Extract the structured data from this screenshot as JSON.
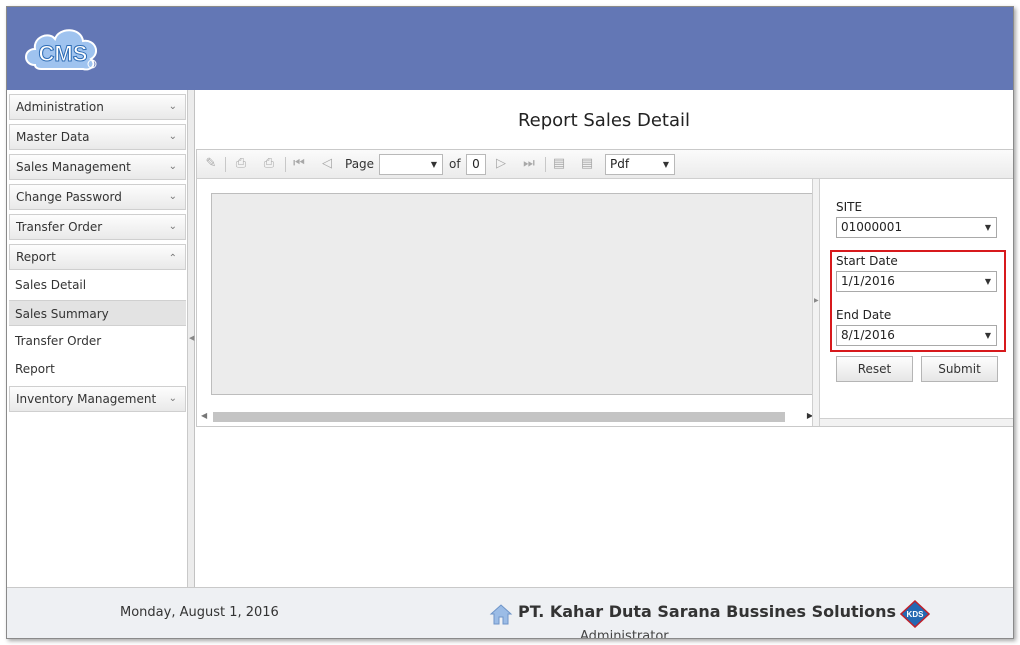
{
  "header": {
    "logo_text": "CMS"
  },
  "sidebar": {
    "items": [
      {
        "label": "Administration",
        "chevron": "chevron-down-icon"
      },
      {
        "label": "Master Data",
        "chevron": "chevron-down-icon"
      },
      {
        "label": "Sales Management",
        "chevron": "chevron-down-icon"
      },
      {
        "label": "Change Password",
        "chevron": "chevron-down-icon"
      },
      {
        "label": "Transfer Order",
        "chevron": "chevron-down-icon"
      },
      {
        "label": "Report",
        "chevron": "chevron-up-icon",
        "expanded": true
      },
      {
        "label": "Inventory Management",
        "chevron": "chevron-down-icon"
      }
    ],
    "report_subitems": [
      {
        "label": "Sales Detail"
      },
      {
        "label": "Sales Summary",
        "selected": true
      },
      {
        "label": "Transfer Order"
      },
      {
        "label": "Report"
      }
    ]
  },
  "main": {
    "title": "Report Sales Detail",
    "toolbar": {
      "page_label": "Page",
      "page_value": "",
      "of_label": "of",
      "total_pages": "0",
      "export_format": "Pdf"
    },
    "params": {
      "site_label": "SITE",
      "site_value": "01000001",
      "start_label": "Start Date",
      "start_value": "1/1/2016",
      "end_label": "End Date",
      "end_value": "8/1/2016",
      "reset_label": "Reset",
      "submit_label": "Submit"
    }
  },
  "footer": {
    "date": "Monday, August 1, 2016",
    "company": "PT. Kahar Duta Sarana Bussines Solutions",
    "user": "Administrator"
  },
  "colors": {
    "header_bg": "#6377b5",
    "highlight": "#d7191c",
    "footer_bg": "#eef0f3"
  }
}
